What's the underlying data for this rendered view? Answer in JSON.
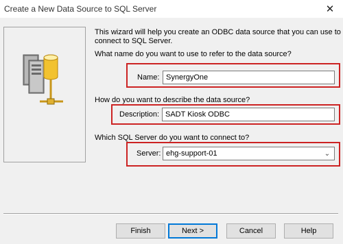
{
  "window": {
    "title": "Create a New Data Source to SQL Server",
    "close_glyph": "✕"
  },
  "intro": {
    "line1": "This wizard will help you create an ODBC data source that you can use to",
    "line2": "connect to SQL Server."
  },
  "name_section": {
    "question": "What name do you want to use to refer to the data source?",
    "label": "Name:",
    "value": "SynergyOne"
  },
  "description_section": {
    "question": "How do you want to describe the data source?",
    "label": "Description:",
    "value": "SADT Kiosk ODBC"
  },
  "server_section": {
    "question": "Which SQL Server do you want to connect to?",
    "label": "Server:",
    "value": "ehg-support-01"
  },
  "buttons": {
    "finish": "Finish",
    "next": "Next >",
    "cancel": "Cancel",
    "help": "Help"
  },
  "icons": {
    "wizard_art": "database-server-icon",
    "combo": "chevron-down-icon",
    "close": "close-icon"
  },
  "colors": {
    "highlight": "#cc2222",
    "cylinder": "#f2c230"
  }
}
